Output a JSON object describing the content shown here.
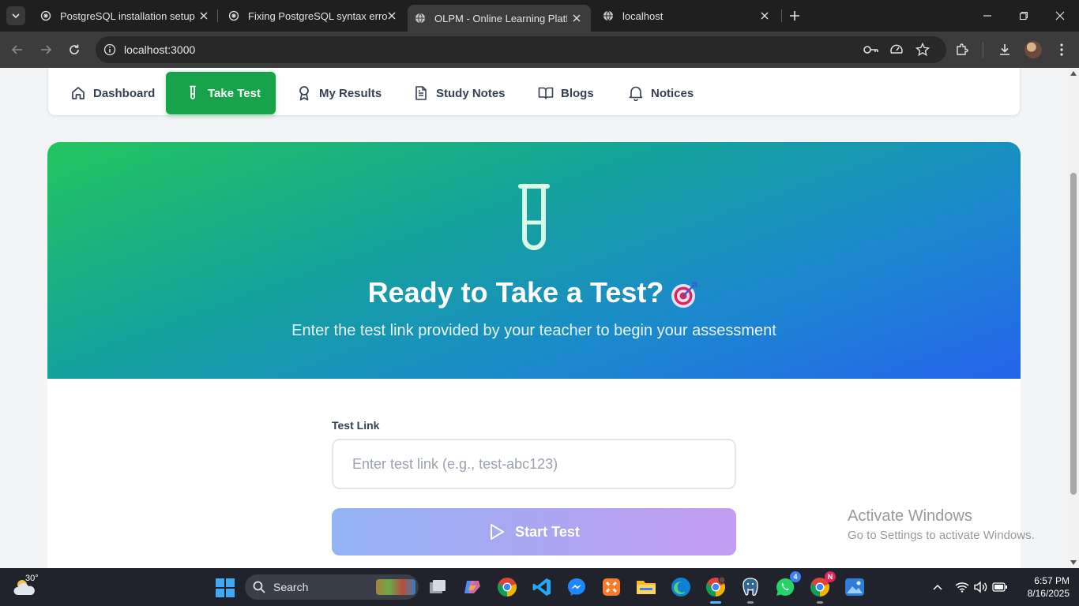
{
  "browser": {
    "tabs": [
      {
        "title": "PostgreSQL installation setup",
        "active": false
      },
      {
        "title": "Fixing PostgreSQL syntax error",
        "active": false
      },
      {
        "title": "OLPM - Online Learning Platform",
        "active": true
      },
      {
        "title": "localhost",
        "active": false
      }
    ],
    "url": "localhost:3000"
  },
  "nav": {
    "items": [
      {
        "label": "Dashboard",
        "icon": "home-icon",
        "active": false
      },
      {
        "label": "Take Test",
        "icon": "test-tube-icon",
        "active": true
      },
      {
        "label": "My Results",
        "icon": "award-icon",
        "active": false
      },
      {
        "label": "Study Notes",
        "icon": "document-icon",
        "active": false
      },
      {
        "label": "Blogs",
        "icon": "book-open-icon",
        "active": false
      },
      {
        "label": "Notices",
        "icon": "bell-icon",
        "active": false
      }
    ]
  },
  "hero": {
    "icon": "test-tube-icon",
    "title": "Ready to Take a Test?",
    "title_emoji": "target-emoji",
    "subtitle": "Enter the test link provided by your teacher to begin your assessment"
  },
  "form": {
    "label": "Test Link",
    "value": "",
    "placeholder": "Enter test link (e.g., test-abc123)",
    "button_label": "Start Test",
    "button_icon": "play-icon"
  },
  "watermark": {
    "title": "Activate Windows",
    "subtitle": "Go to Settings to activate Windows."
  },
  "taskbar": {
    "weather_temp": "30°",
    "search_label": "Search",
    "whatsapp_badge": "4",
    "chrome_badge": "N",
    "time": "6:57 PM",
    "date": "8/16/2025"
  },
  "colors": {
    "accent": "#16a34a",
    "hero_gradient_start": "#22c55e",
    "hero_gradient_end": "#2563eb",
    "button_gradient_start": "#93b4f5",
    "button_gradient_end": "#c59cf1"
  }
}
